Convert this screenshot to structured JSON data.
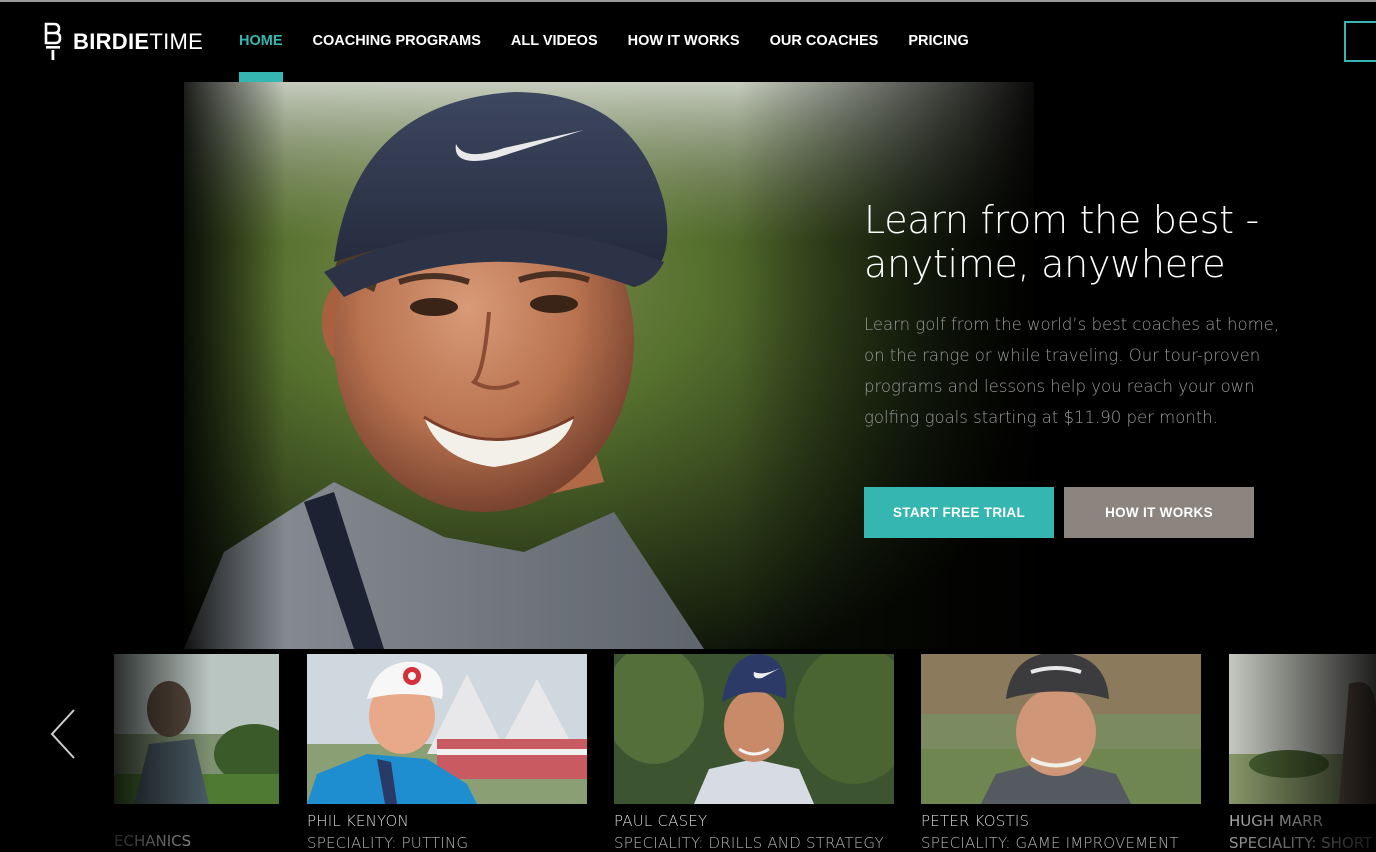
{
  "brand": {
    "logo_bold": "BIRDIE",
    "logo_light": "TIME",
    "accent_color": "#36b6b1",
    "secondary_button_color": "#8c857f"
  },
  "nav": {
    "items": [
      {
        "label": "HOME",
        "active": true
      },
      {
        "label": "COACHING PROGRAMS",
        "active": false
      },
      {
        "label": "ALL VIDEOS",
        "active": false
      },
      {
        "label": "HOW IT WORKS",
        "active": false
      },
      {
        "label": "OUR COACHES",
        "active": false
      },
      {
        "label": "PRICING",
        "active": false
      }
    ]
  },
  "hero": {
    "title_line1": "Learn from the best -",
    "title_line2": "anytime, anywhere",
    "description": "Learn golf from the world’s best coaches at home, on the range or while traveling. Our tour-proven programs and lessons help you reach your own golfing goals starting at $11.90 per month.",
    "primary_button": "START FREE TRIAL",
    "secondary_button": "HOW IT WORKS"
  },
  "coaches": {
    "prev_icon": "chevron-left-icon",
    "partial_left_label": "ECHANICS",
    "cards": [
      {
        "name": "PHIL KENYON",
        "speciality": "SPECIALITY: PUTTING"
      },
      {
        "name": "PAUL CASEY",
        "speciality": "SPECIALITY: DRILLS AND STRATEGY"
      },
      {
        "name": "PETER KOSTIS",
        "speciality": "SPECIALITY: GAME IMPROVEMENT"
      },
      {
        "name": "HUGH MARR",
        "speciality": "SPECIALITY: SHORT GAME"
      }
    ]
  }
}
